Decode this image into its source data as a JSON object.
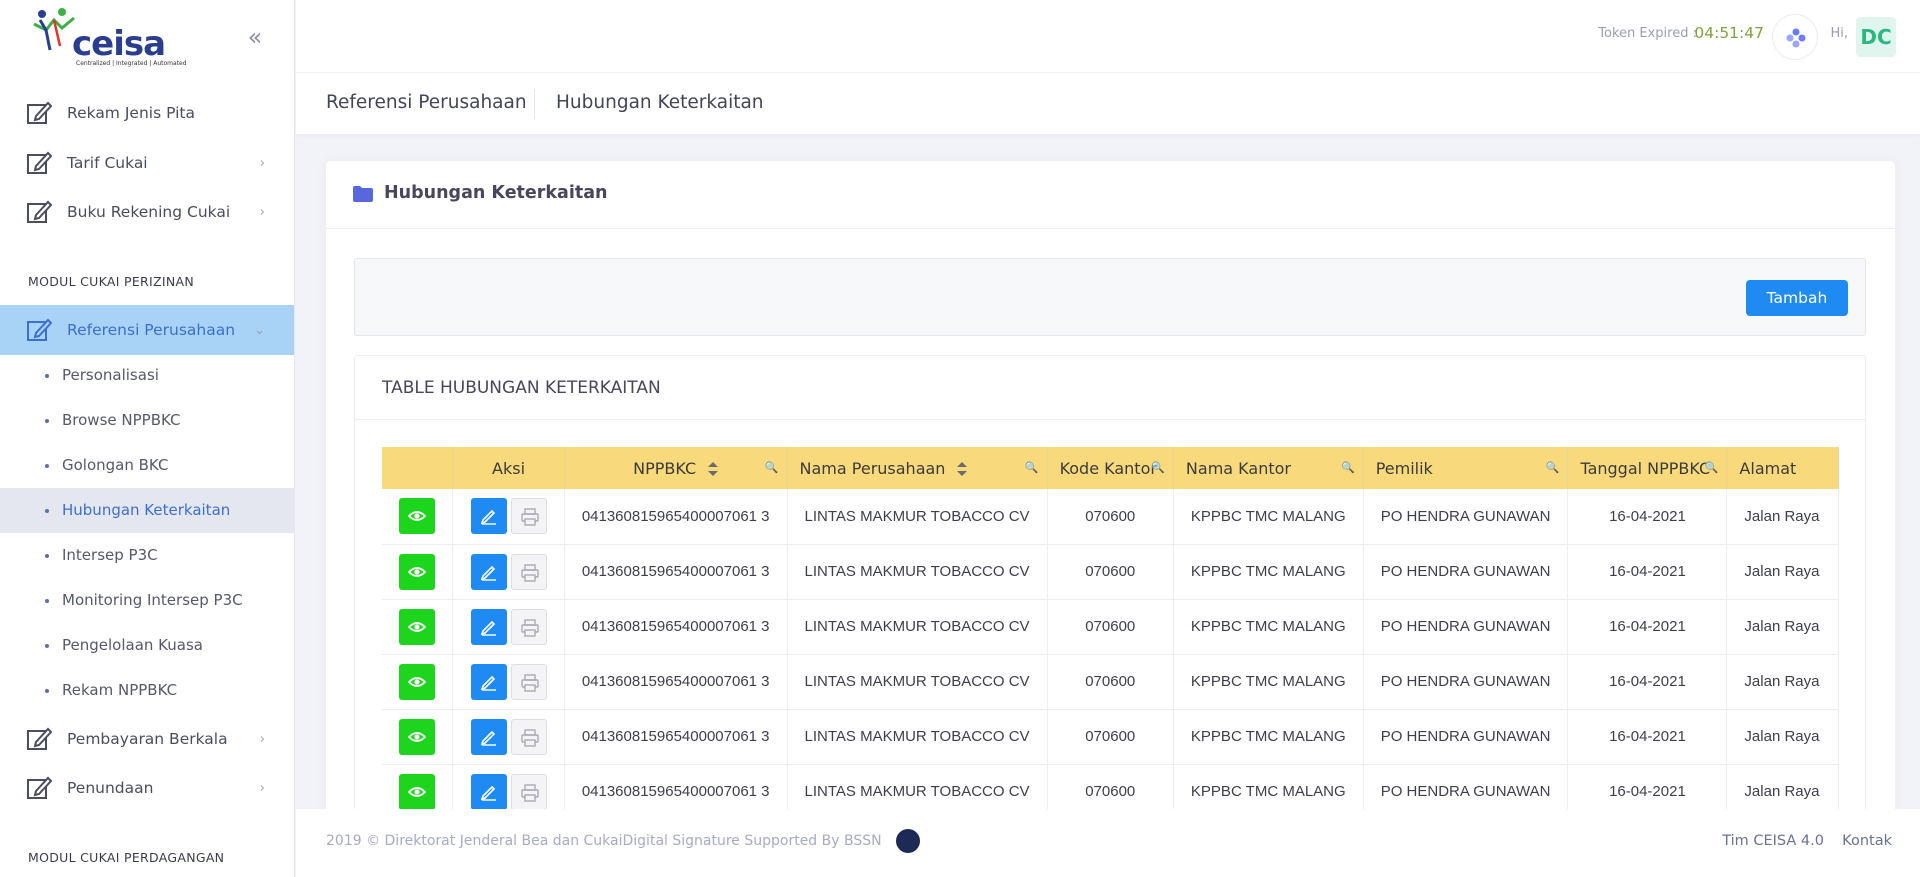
{
  "brand": {
    "name": "ceisa",
    "tagline": "Centralized | Integrated | Automated"
  },
  "sidebar": {
    "items_top": [
      {
        "label": "Rekam Jenis Pita",
        "arrow": ""
      },
      {
        "label": "Tarif Cukai",
        "arrow": "›"
      },
      {
        "label": "Buku Rekening Cukai",
        "arrow": "›"
      }
    ],
    "section1": "MODUL CUKAI PERIZINAN",
    "active_parent": {
      "label": "Referensi Perusahaan",
      "arrow": "⌄"
    },
    "subitems": [
      "Personalisasi",
      "Browse NPPBKC",
      "Golongan BKC",
      "Hubungan Keterkaitan",
      "Intersep P3C",
      "Monitoring Intersep P3C",
      "Pengelolaan Kuasa",
      "Rekam NPPBKC"
    ],
    "active_subitem_index": 3,
    "items_bottom": [
      {
        "label": "Pembayaran Berkala",
        "arrow": "›"
      },
      {
        "label": "Penundaan",
        "arrow": "›"
      }
    ],
    "section2": "MODUL CUKAI PERDAGANGAN"
  },
  "header": {
    "token_label": "Token Expired :",
    "token_time": "04:51:47",
    "greeting": "Hi,",
    "avatar": "DC"
  },
  "breadcrumb": {
    "parent": "Referensi Perusahaan",
    "current": "Hubungan Keterkaitan"
  },
  "portlet": {
    "title": "Hubungan Keterkaitan",
    "add_button": "Tambah"
  },
  "table": {
    "title": "TABLE HUBUNGAN KETERKAITAN",
    "columns": [
      "",
      "Aksi",
      "NPPBKC",
      "Nama Perusahaan",
      "Kode Kantor",
      "Nama Kantor",
      "Pemilik",
      "Tanggal NPPBKC",
      "Alamat"
    ],
    "rows": [
      [
        "041360815965400007061 3",
        "LINTAS MAKMUR TOBACCO CV",
        "070600",
        "KPPBC TMC MALANG",
        "PO HENDRA GUNAWAN",
        "16-04-2021",
        "Jalan Raya"
      ],
      [
        "041360815965400007061 3",
        "LINTAS MAKMUR TOBACCO CV",
        "070600",
        "KPPBC TMC MALANG",
        "PO HENDRA GUNAWAN",
        "16-04-2021",
        "Jalan Raya"
      ],
      [
        "041360815965400007061 3",
        "LINTAS MAKMUR TOBACCO CV",
        "070600",
        "KPPBC TMC MALANG",
        "PO HENDRA GUNAWAN",
        "16-04-2021",
        "Jalan Raya"
      ],
      [
        "041360815965400007061 3",
        "LINTAS MAKMUR TOBACCO CV",
        "070600",
        "KPPBC TMC MALANG",
        "PO HENDRA GUNAWAN",
        "16-04-2021",
        "Jalan Raya"
      ],
      [
        "041360815965400007061 3",
        "LINTAS MAKMUR TOBACCO CV",
        "070600",
        "KPPBC TMC MALANG",
        "PO HENDRA GUNAWAN",
        "16-04-2021",
        "Jalan Raya"
      ],
      [
        "041360815965400007061 3",
        "LINTAS MAKMUR TOBACCO CV",
        "070600",
        "KPPBC TMC MALANG",
        "PO HENDRA GUNAWAN",
        "16-04-2021",
        "Jalan Raya"
      ]
    ]
  },
  "footer": {
    "copyright": "2019 © Direktorat Jenderal Bea dan CukaiDigital Signature Supported By BSSN",
    "link1": "Tim CEISA 4.0",
    "link2": "Kontak"
  },
  "colors": {
    "accent": "#1f8bf2",
    "view_button": "#1ed51e",
    "table_header": "#f8da7c",
    "active_menu": "#a9d3f6",
    "token_time": "#7ea340"
  }
}
